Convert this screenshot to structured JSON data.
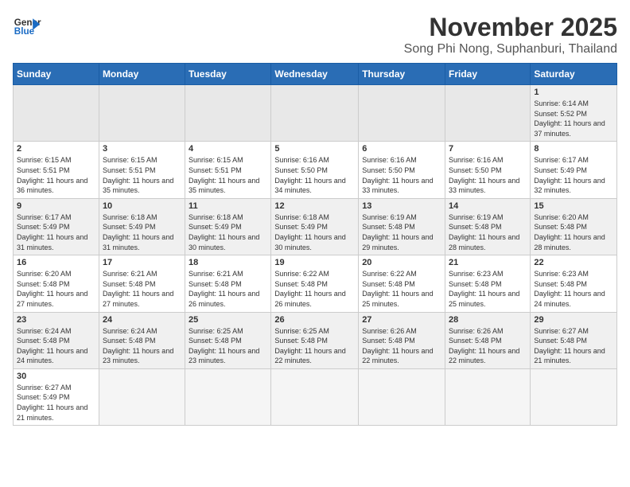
{
  "header": {
    "logo_general": "General",
    "logo_blue": "Blue",
    "month": "November 2025",
    "location": "Song Phi Nong, Suphanburi, Thailand"
  },
  "weekdays": [
    "Sunday",
    "Monday",
    "Tuesday",
    "Wednesday",
    "Thursday",
    "Friday",
    "Saturday"
  ],
  "weeks": [
    [
      {
        "day": "",
        "info": ""
      },
      {
        "day": "",
        "info": ""
      },
      {
        "day": "",
        "info": ""
      },
      {
        "day": "",
        "info": ""
      },
      {
        "day": "",
        "info": ""
      },
      {
        "day": "",
        "info": ""
      },
      {
        "day": "1",
        "info": "Sunrise: 6:14 AM\nSunset: 5:52 PM\nDaylight: 11 hours\nand 37 minutes."
      }
    ],
    [
      {
        "day": "2",
        "info": "Sunrise: 6:15 AM\nSunset: 5:51 PM\nDaylight: 11 hours\nand 36 minutes."
      },
      {
        "day": "3",
        "info": "Sunrise: 6:15 AM\nSunset: 5:51 PM\nDaylight: 11 hours\nand 35 minutes."
      },
      {
        "day": "4",
        "info": "Sunrise: 6:15 AM\nSunset: 5:51 PM\nDaylight: 11 hours\nand 35 minutes."
      },
      {
        "day": "5",
        "info": "Sunrise: 6:16 AM\nSunset: 5:50 PM\nDaylight: 11 hours\nand 34 minutes."
      },
      {
        "day": "6",
        "info": "Sunrise: 6:16 AM\nSunset: 5:50 PM\nDaylight: 11 hours\nand 33 minutes."
      },
      {
        "day": "7",
        "info": "Sunrise: 6:16 AM\nSunset: 5:50 PM\nDaylight: 11 hours\nand 33 minutes."
      },
      {
        "day": "8",
        "info": "Sunrise: 6:17 AM\nSunset: 5:49 PM\nDaylight: 11 hours\nand 32 minutes."
      }
    ],
    [
      {
        "day": "9",
        "info": "Sunrise: 6:17 AM\nSunset: 5:49 PM\nDaylight: 11 hours\nand 31 minutes."
      },
      {
        "day": "10",
        "info": "Sunrise: 6:18 AM\nSunset: 5:49 PM\nDaylight: 11 hours\nand 31 minutes."
      },
      {
        "day": "11",
        "info": "Sunrise: 6:18 AM\nSunset: 5:49 PM\nDaylight: 11 hours\nand 30 minutes."
      },
      {
        "day": "12",
        "info": "Sunrise: 6:18 AM\nSunset: 5:49 PM\nDaylight: 11 hours\nand 30 minutes."
      },
      {
        "day": "13",
        "info": "Sunrise: 6:19 AM\nSunset: 5:48 PM\nDaylight: 11 hours\nand 29 minutes."
      },
      {
        "day": "14",
        "info": "Sunrise: 6:19 AM\nSunset: 5:48 PM\nDaylight: 11 hours\nand 28 minutes."
      },
      {
        "day": "15",
        "info": "Sunrise: 6:20 AM\nSunset: 5:48 PM\nDaylight: 11 hours\nand 28 minutes."
      }
    ],
    [
      {
        "day": "16",
        "info": "Sunrise: 6:20 AM\nSunset: 5:48 PM\nDaylight: 11 hours\nand 27 minutes."
      },
      {
        "day": "17",
        "info": "Sunrise: 6:21 AM\nSunset: 5:48 PM\nDaylight: 11 hours\nand 27 minutes."
      },
      {
        "day": "18",
        "info": "Sunrise: 6:21 AM\nSunset: 5:48 PM\nDaylight: 11 hours\nand 26 minutes."
      },
      {
        "day": "19",
        "info": "Sunrise: 6:22 AM\nSunset: 5:48 PM\nDaylight: 11 hours\nand 26 minutes."
      },
      {
        "day": "20",
        "info": "Sunrise: 6:22 AM\nSunset: 5:48 PM\nDaylight: 11 hours\nand 25 minutes."
      },
      {
        "day": "21",
        "info": "Sunrise: 6:23 AM\nSunset: 5:48 PM\nDaylight: 11 hours\nand 25 minutes."
      },
      {
        "day": "22",
        "info": "Sunrise: 6:23 AM\nSunset: 5:48 PM\nDaylight: 11 hours\nand 24 minutes."
      }
    ],
    [
      {
        "day": "23",
        "info": "Sunrise: 6:24 AM\nSunset: 5:48 PM\nDaylight: 11 hours\nand 24 minutes."
      },
      {
        "day": "24",
        "info": "Sunrise: 6:24 AM\nSunset: 5:48 PM\nDaylight: 11 hours\nand 23 minutes."
      },
      {
        "day": "25",
        "info": "Sunrise: 6:25 AM\nSunset: 5:48 PM\nDaylight: 11 hours\nand 23 minutes."
      },
      {
        "day": "26",
        "info": "Sunrise: 6:25 AM\nSunset: 5:48 PM\nDaylight: 11 hours\nand 22 minutes."
      },
      {
        "day": "27",
        "info": "Sunrise: 6:26 AM\nSunset: 5:48 PM\nDaylight: 11 hours\nand 22 minutes."
      },
      {
        "day": "28",
        "info": "Sunrise: 6:26 AM\nSunset: 5:48 PM\nDaylight: 11 hours\nand 22 minutes."
      },
      {
        "day": "29",
        "info": "Sunrise: 6:27 AM\nSunset: 5:48 PM\nDaylight: 11 hours\nand 21 minutes."
      }
    ],
    [
      {
        "day": "30",
        "info": "Sunrise: 6:27 AM\nSunset: 5:49 PM\nDaylight: 11 hours\nand 21 minutes."
      },
      {
        "day": "",
        "info": ""
      },
      {
        "day": "",
        "info": ""
      },
      {
        "day": "",
        "info": ""
      },
      {
        "day": "",
        "info": ""
      },
      {
        "day": "",
        "info": ""
      },
      {
        "day": "",
        "info": ""
      }
    ]
  ]
}
